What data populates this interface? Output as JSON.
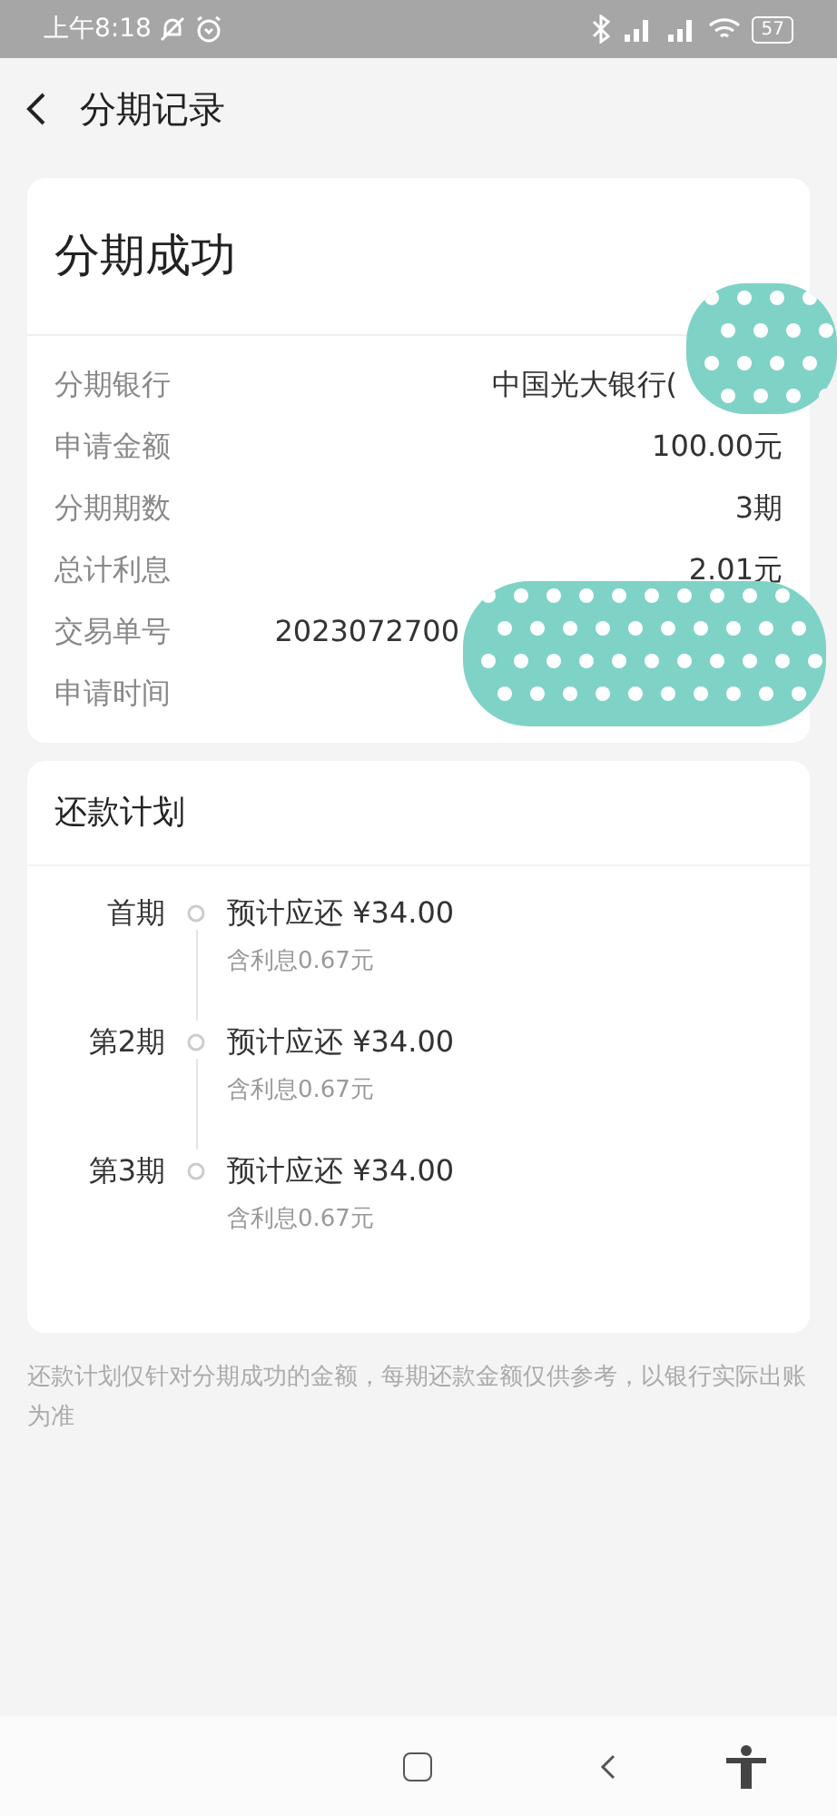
{
  "status_bar": {
    "time": "上午8:18",
    "battery": "57"
  },
  "header": {
    "title": "分期记录"
  },
  "result_card": {
    "title": "分期成功",
    "rows": [
      {
        "label": "分期银行",
        "value": "中国光大银行("
      },
      {
        "label": "申请金额",
        "value": "100.00元"
      },
      {
        "label": "分期期数",
        "value": "3期"
      },
      {
        "label": "总计利息",
        "value": "2.01元"
      },
      {
        "label": "交易单号",
        "value": "2023072700"
      },
      {
        "label": "申请时间"
      }
    ]
  },
  "plan_card": {
    "title": "还款计划",
    "items": [
      {
        "period": "首期",
        "amount": "预计应还 ¥34.00",
        "interest": "含利息0.67元"
      },
      {
        "period": "第2期",
        "amount": "预计应还 ¥34.00",
        "interest": "含利息0.67元"
      },
      {
        "period": "第3期",
        "amount": "预计应还 ¥34.00",
        "interest": "含利息0.67元"
      }
    ]
  },
  "footnote": "还款计划仅针对分期成功的金额，每期还款金额仅供参考，以银行实际出账为准"
}
